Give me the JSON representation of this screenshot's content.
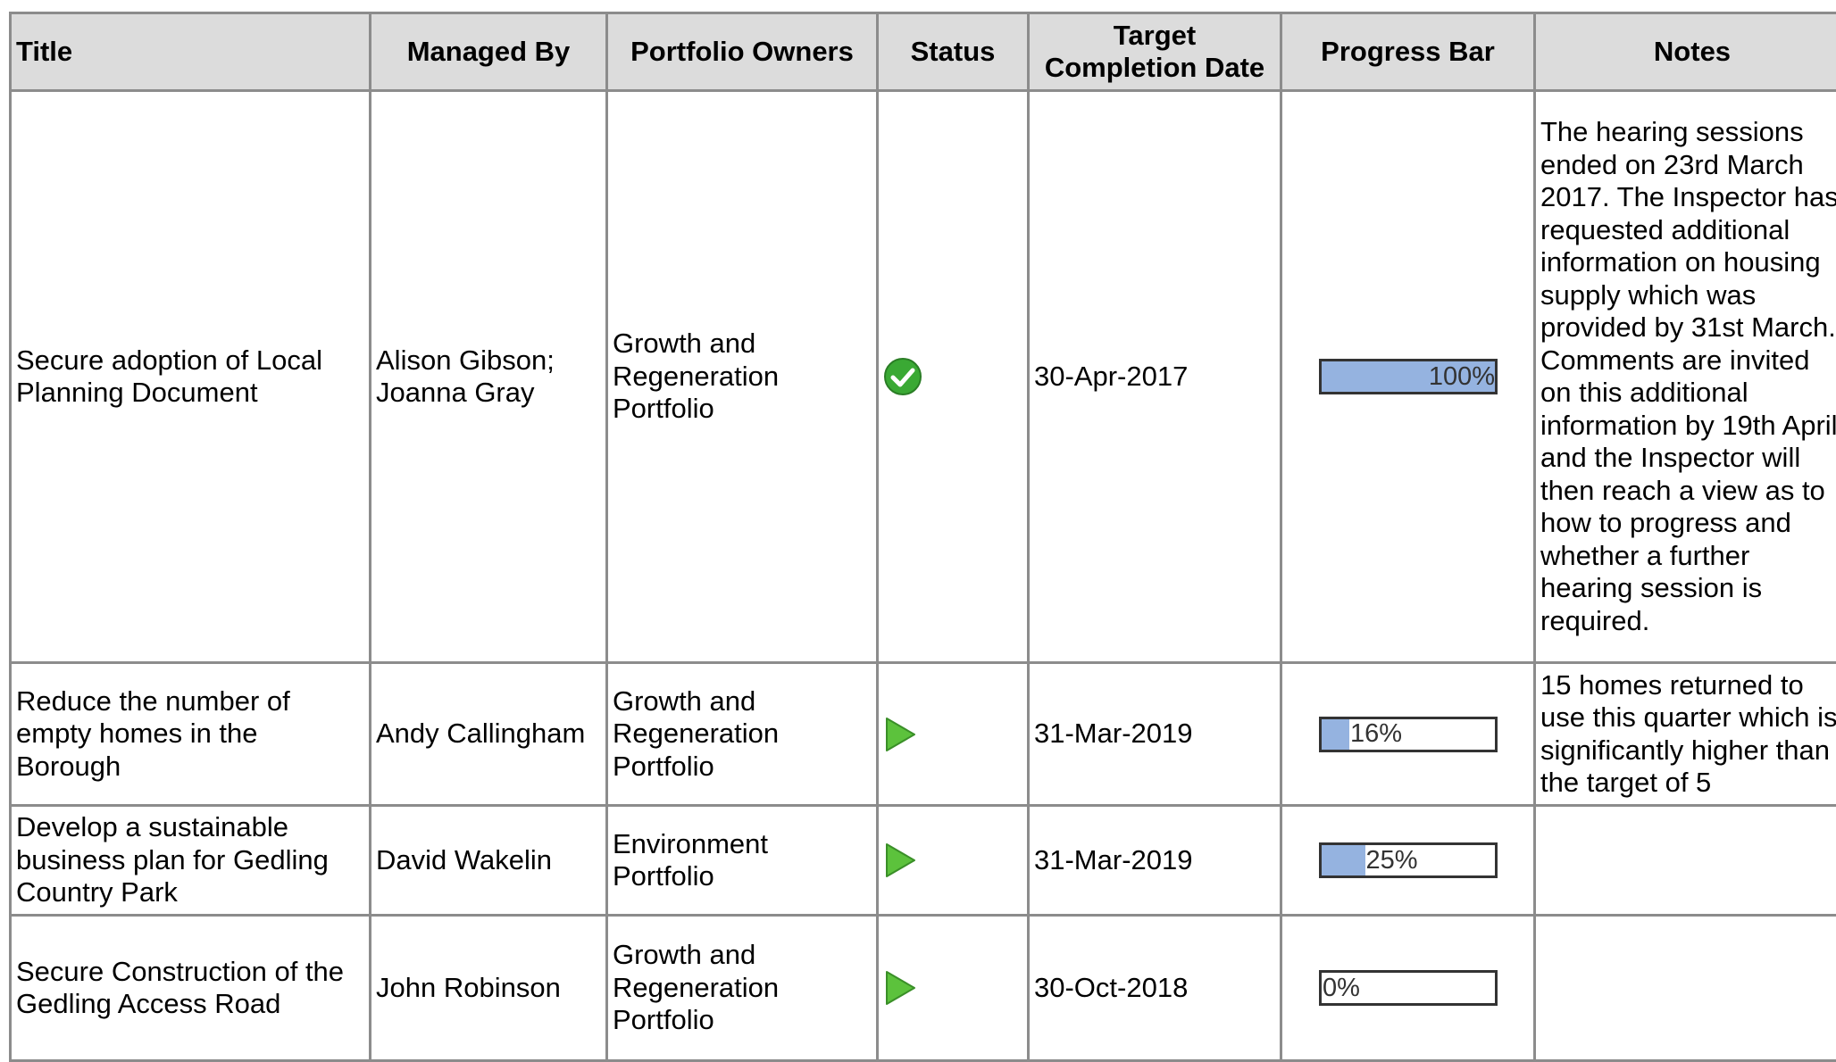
{
  "headers": {
    "title": "Title",
    "managed_by": "Managed By",
    "portfolio_owners": "Portfolio Owners",
    "status": "Status",
    "target_date": "Target Completion Date",
    "progress": "Progress Bar",
    "notes": "Notes"
  },
  "rows": [
    {
      "title": "Secure adoption of Local Planning Document",
      "managed_by": "Alison Gibson; Joanna Gray",
      "portfolio": "Growth and Regeneration Portfolio",
      "status_icon": "check-circle-icon",
      "target_date": "30-Apr-2017",
      "progress_value": 100,
      "progress_label": "100%",
      "notes": "The hearing sessions ended on 23rd March 2017. The Inspector has requested additional information on housing supply which was provided by 31st March. Comments are invited on this additional information by 19th April and the Inspector will then reach a view as to how to progress and whether a further hearing session is required."
    },
    {
      "title": "Reduce the number of empty homes in the Borough",
      "managed_by": "Andy Callingham",
      "portfolio": "Growth and Regeneration Portfolio",
      "status_icon": "play-arrow-icon",
      "target_date": "31-Mar-2019",
      "progress_value": 16,
      "progress_label": "16%",
      "notes": "15 homes returned to use this quarter which is significantly higher than the target of 5"
    },
    {
      "title": "Develop a sustainable business plan for Gedling Country Park",
      "managed_by": "David Wakelin",
      "portfolio": "Environment Portfolio",
      "status_icon": "play-arrow-icon",
      "target_date": "31-Mar-2019",
      "progress_value": 25,
      "progress_label": "25%",
      "notes": ""
    },
    {
      "title": "Secure Construction of the Gedling Access Road",
      "managed_by": "John Robinson",
      "portfolio": "Growth and Regeneration Portfolio",
      "status_icon": "play-arrow-icon",
      "target_date": "30-Oct-2018",
      "progress_value": 0,
      "progress_label": "0%",
      "notes": ""
    }
  ],
  "colors": {
    "header_bg": "#dcdcdc",
    "grid": "#8c8c8c",
    "progress_fill": "#95b3e0",
    "status_complete": "#3aa934",
    "status_in_progress": "#5cc23c"
  }
}
